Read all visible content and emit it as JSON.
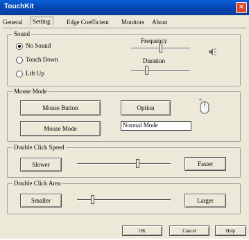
{
  "window": {
    "title": "TouchKit",
    "close_symbol": "✕"
  },
  "tabs": [
    {
      "label": "General"
    },
    {
      "label": "Setting"
    },
    {
      "label": "Edge Coefficient"
    },
    {
      "label": "Monitors"
    },
    {
      "label": "About"
    }
  ],
  "sound": {
    "group_label": "Sound",
    "options": [
      {
        "label": "No Sound",
        "selected": true
      },
      {
        "label": "Touch Down",
        "selected": false
      },
      {
        "label": "Lift Up",
        "selected": false
      }
    ],
    "frequency_label": "Frequency",
    "frequency_level": 0.5,
    "duration_label": "Duration",
    "duration_level": 0.25
  },
  "mouse_mode": {
    "group_label": "Mouse Mode",
    "mouse_button_label": "Mouse Button",
    "option_label": "Option",
    "mouse_mode_button_label": "Mouse Mode",
    "mode_value": "Normal Mode"
  },
  "double_click_speed": {
    "group_label": "Double Click Speed",
    "slower_label": "Slower",
    "faster_label": "Faster",
    "level": 0.65
  },
  "double_click_area": {
    "group_label": "Double Click Area",
    "smaller_label": "Smaller",
    "larger_label": "Larger",
    "level": 0.15
  },
  "footer": {
    "ok_label": "OK",
    "cancel_label": "Cancel",
    "help_label": "Help"
  }
}
